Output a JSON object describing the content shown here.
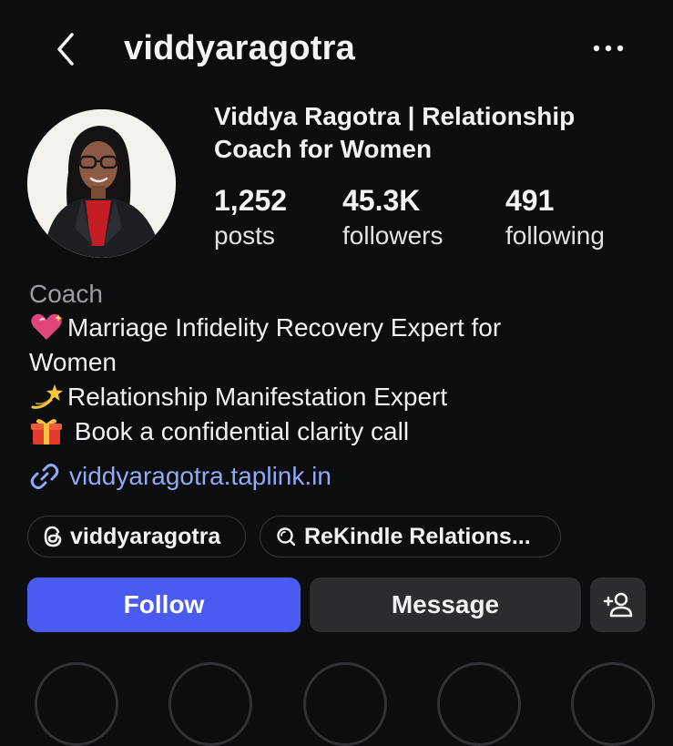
{
  "header": {
    "username": "viddyaragotra",
    "back_icon": "chevron-left-icon",
    "more_icon": "more-horizontal-icon"
  },
  "profile": {
    "display_name": "Viddya Ragotra | Relationship Coach for Women",
    "stats": [
      {
        "value": "1,252",
        "label": "posts"
      },
      {
        "value": "45.3K",
        "label": "followers"
      },
      {
        "value": "491",
        "label": "following"
      }
    ],
    "category": "Coach",
    "bio": [
      {
        "emoji": "sparkling-heart-icon",
        "text": "Marriage Infidelity Recovery Expert for"
      },
      {
        "emoji": "",
        "text": "Women"
      },
      {
        "emoji": "dizzy-star-icon",
        "text": "Relationship Manifestation Expert"
      },
      {
        "emoji": "gift-icon",
        "text": " Book a confidential clarity call"
      }
    ],
    "link": "viddyaragotra.taplink.in"
  },
  "chips": {
    "threads": "viddyaragotra",
    "rekindle": "ReKindle Relations..."
  },
  "actions": {
    "follow": "Follow",
    "message": "Message"
  },
  "colors": {
    "background": "#0c0d0f",
    "follow_button": "#4a5cf0",
    "secondary_button": "#2a2c30",
    "link": "#8fa9f5",
    "muted_text": "#9a9ea4"
  }
}
